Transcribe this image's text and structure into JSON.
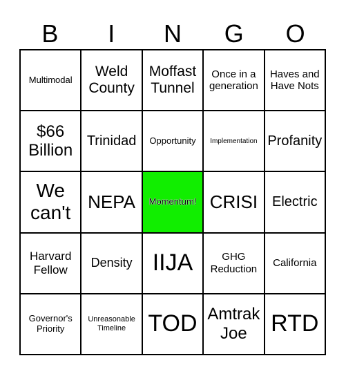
{
  "header": {
    "letters": [
      "B",
      "I",
      "N",
      "G",
      "O"
    ]
  },
  "free_space_color": "#11ee00",
  "cells": [
    {
      "text": "Multimodal",
      "size": "s13"
    },
    {
      "text": "Weld County",
      "size": "s21"
    },
    {
      "text": "Moffast Tunnel",
      "size": "s21"
    },
    {
      "text": "Once in a generation",
      "size": "s15"
    },
    {
      "text": "Haves and Have Nots",
      "size": "s15"
    },
    {
      "text": "$66 Billion",
      "size": "s24"
    },
    {
      "text": "Trinidad",
      "size": "s20"
    },
    {
      "text": "Opportunity",
      "size": "s13"
    },
    {
      "text": "Implementation",
      "size": "s10"
    },
    {
      "text": "Profanity",
      "size": "s20"
    },
    {
      "text": "We can't",
      "size": "s28"
    },
    {
      "text": "NEPA",
      "size": "s26"
    },
    {
      "text": "Momentum!",
      "size": "s13",
      "free": true
    },
    {
      "text": "CRISI",
      "size": "s26"
    },
    {
      "text": "Electric",
      "size": "s20"
    },
    {
      "text": "Harvard Fellow",
      "size": "s17"
    },
    {
      "text": "Density",
      "size": "s18"
    },
    {
      "text": "IIJA",
      "size": "s34"
    },
    {
      "text": "GHG Reduction",
      "size": "s15"
    },
    {
      "text": "California",
      "size": "s15"
    },
    {
      "text": "Governor's Priority",
      "size": "s13"
    },
    {
      "text": "Unreasonable Timeline",
      "size": "s11"
    },
    {
      "text": "TOD",
      "size": "s34"
    },
    {
      "text": "Amtrak Joe",
      "size": "s24"
    },
    {
      "text": "RTD",
      "size": "s34"
    }
  ]
}
